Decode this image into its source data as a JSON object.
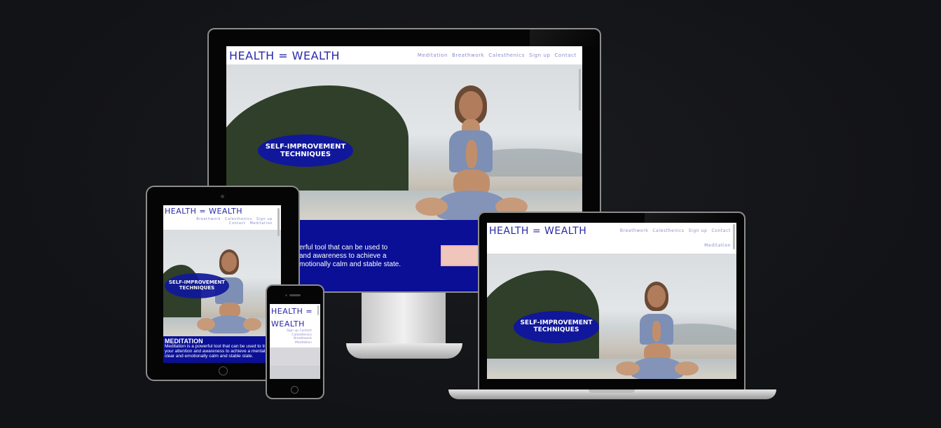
{
  "site": {
    "logo": "HEALTH = WEALTH",
    "logo_line1": "HEALTH =",
    "logo_line2": "WEALTH",
    "nav": [
      "Meditation",
      "Breathwork",
      "Calesthenics",
      "Sign up",
      "Contact"
    ],
    "badge_line1": "SELF-IMPROVEMENT",
    "badge_line2": "TECHNIQUES",
    "section_title": "MEDITATION",
    "section_text": "Meditation is a powerful tool that can be used to train your attention and awareness to achieve a mentally clear and emotionally calm and stable state.",
    "desktop_text_line1": "erful tool that can be used to",
    "desktop_text_line2": "and awareness to achieve a",
    "desktop_text_line3": "motionally calm and stable state."
  },
  "colors": {
    "brand_blue": "#0a0f95",
    "logo_blue": "#2a2aa8",
    "nav_lavender": "#8a8acb",
    "background": "#131417"
  }
}
